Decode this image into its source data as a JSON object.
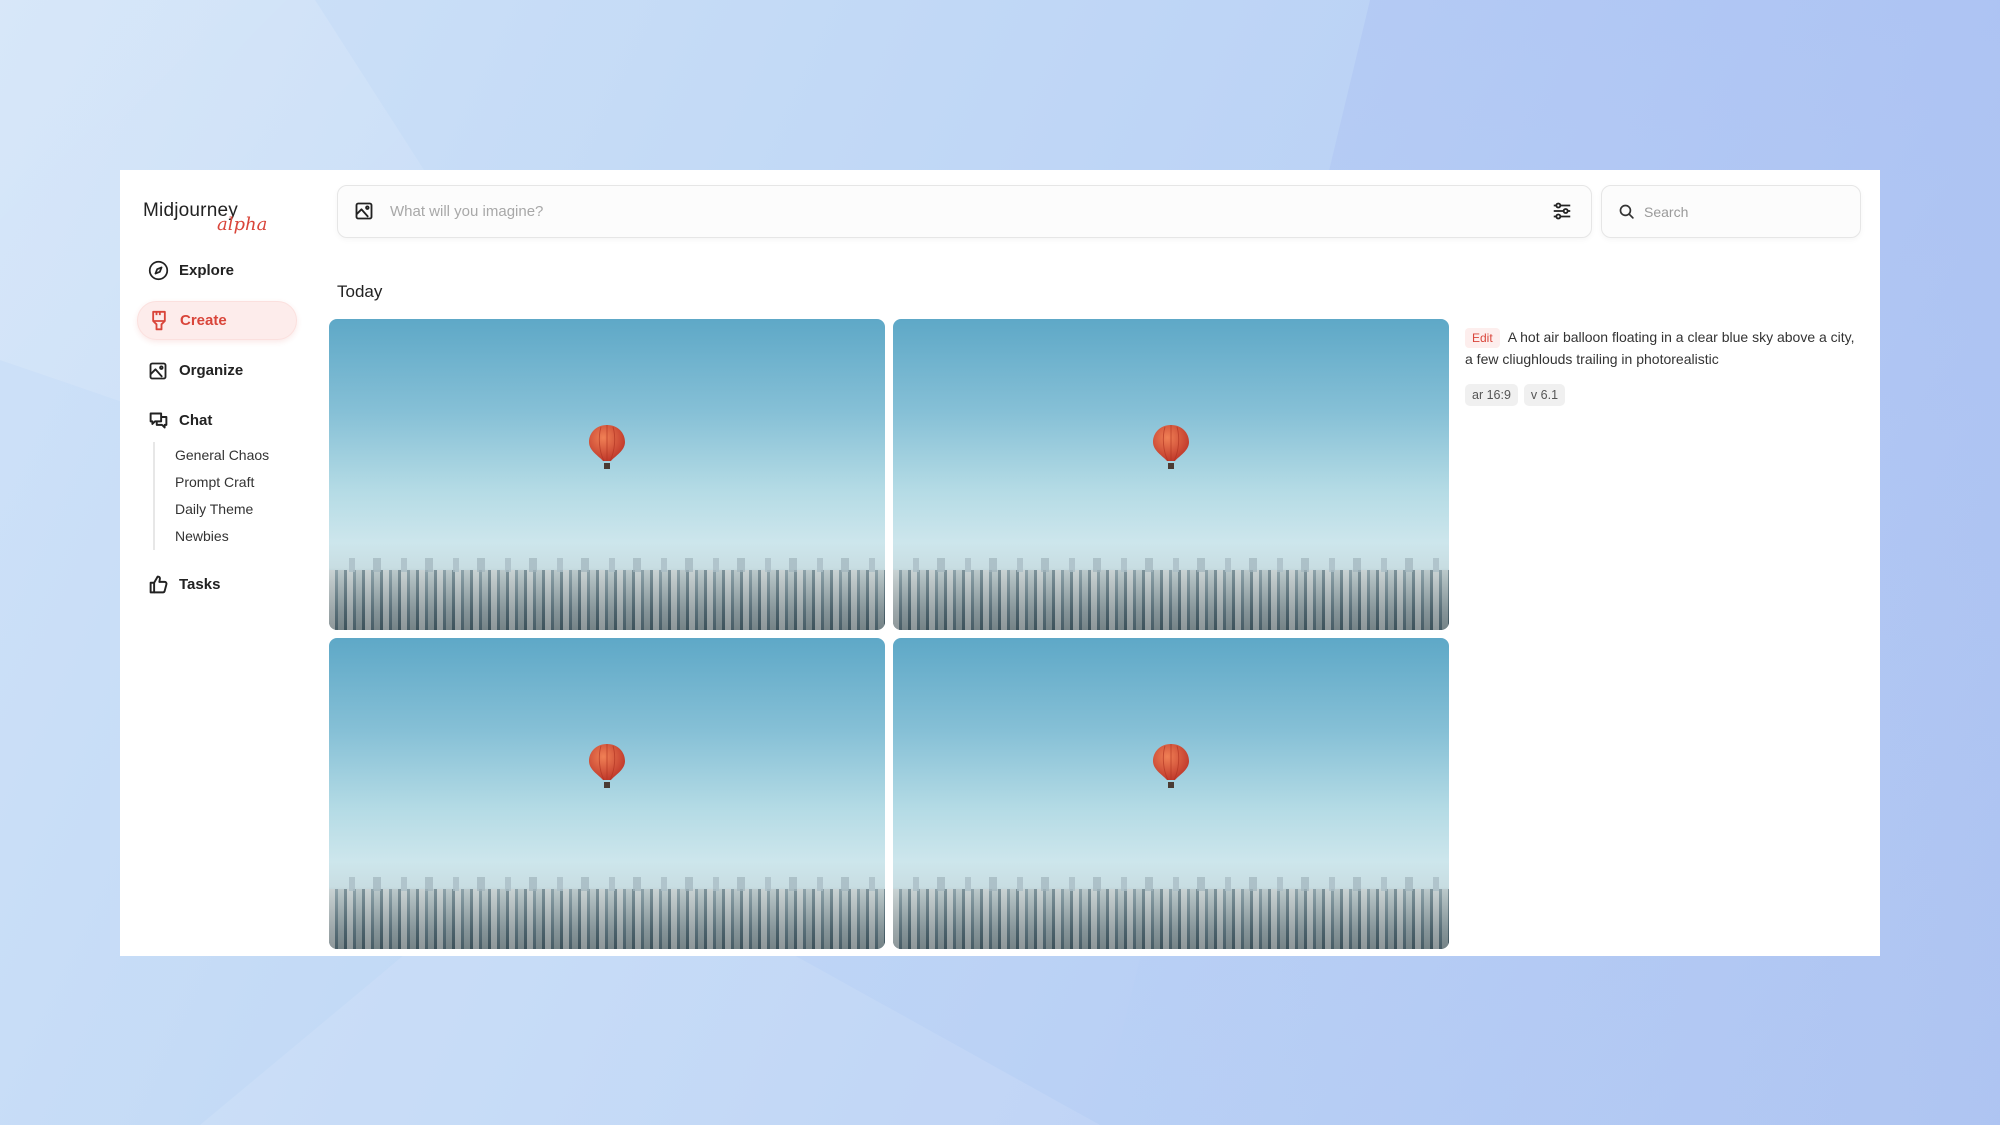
{
  "app": {
    "logo_text": "Midjourney",
    "logo_badge": "alpha"
  },
  "sidebar": {
    "items": [
      {
        "label": "Explore",
        "icon": "compass-icon"
      },
      {
        "label": "Create",
        "icon": "paintbrush-icon",
        "active": true
      },
      {
        "label": "Organize",
        "icon": "image-icon"
      },
      {
        "label": "Chat",
        "icon": "chat-bubbles-icon"
      },
      {
        "label": "Tasks",
        "icon": "thumbs-up-icon"
      }
    ],
    "chat_channels": [
      "General Chaos",
      "Prompt Craft",
      "Daily Theme",
      "Newbies"
    ]
  },
  "prompt_bar": {
    "placeholder": "What will you imagine?",
    "value": ""
  },
  "search": {
    "placeholder": "Search",
    "value": ""
  },
  "main": {
    "section_title": "Today",
    "images": [
      {
        "alt": "Hot air balloon over city 1"
      },
      {
        "alt": "Hot air balloon over city 2"
      },
      {
        "alt": "Hot air balloon over city 3"
      },
      {
        "alt": "Hot air balloon over city 4"
      }
    ]
  },
  "details": {
    "edit_label": "Edit",
    "prompt": "A hot air balloon floating in a clear blue sky above a city, a few cliughlouds trailing in photorealistic",
    "tags": [
      "ar 16:9",
      "v 6.1"
    ]
  },
  "colors": {
    "accent": "#d9453a",
    "accent_bg": "#fdeceb",
    "balloon": "#e0563a"
  }
}
